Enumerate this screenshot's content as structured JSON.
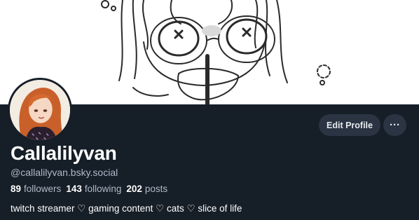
{
  "profile": {
    "display_name": "Callalilyvan",
    "handle": "@callalilyvan.bsky.social",
    "bio": "twitch streamer ♡ gaming content ♡ cats ♡ slice of life"
  },
  "stats": {
    "followers_count": "89",
    "followers_label": "followers",
    "following_count": "143",
    "following_label": "following",
    "posts_count": "202",
    "posts_label": "posts"
  },
  "actions": {
    "edit_profile_label": "Edit Profile",
    "more_label": "···",
    "more_icon": "more-horizontal-icon"
  },
  "colors": {
    "background": "#161e27",
    "button": "#2a3442",
    "secondary_text": "#aebbc9"
  }
}
